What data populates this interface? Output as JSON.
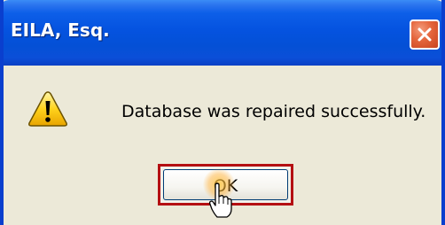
{
  "window": {
    "title": "EILA, Esq.",
    "close_icon": "close-icon"
  },
  "dialog": {
    "icon": "warning-icon",
    "message": "Database was repaired successfully.",
    "ok_label": "OK"
  },
  "cursor": {
    "icon": "hand-pointer-icon"
  },
  "colors": {
    "titlebar": "#0553e0",
    "dialog_bg": "#ece9d8",
    "close_button": "#e4643b",
    "focus_border": "#b40f12"
  }
}
